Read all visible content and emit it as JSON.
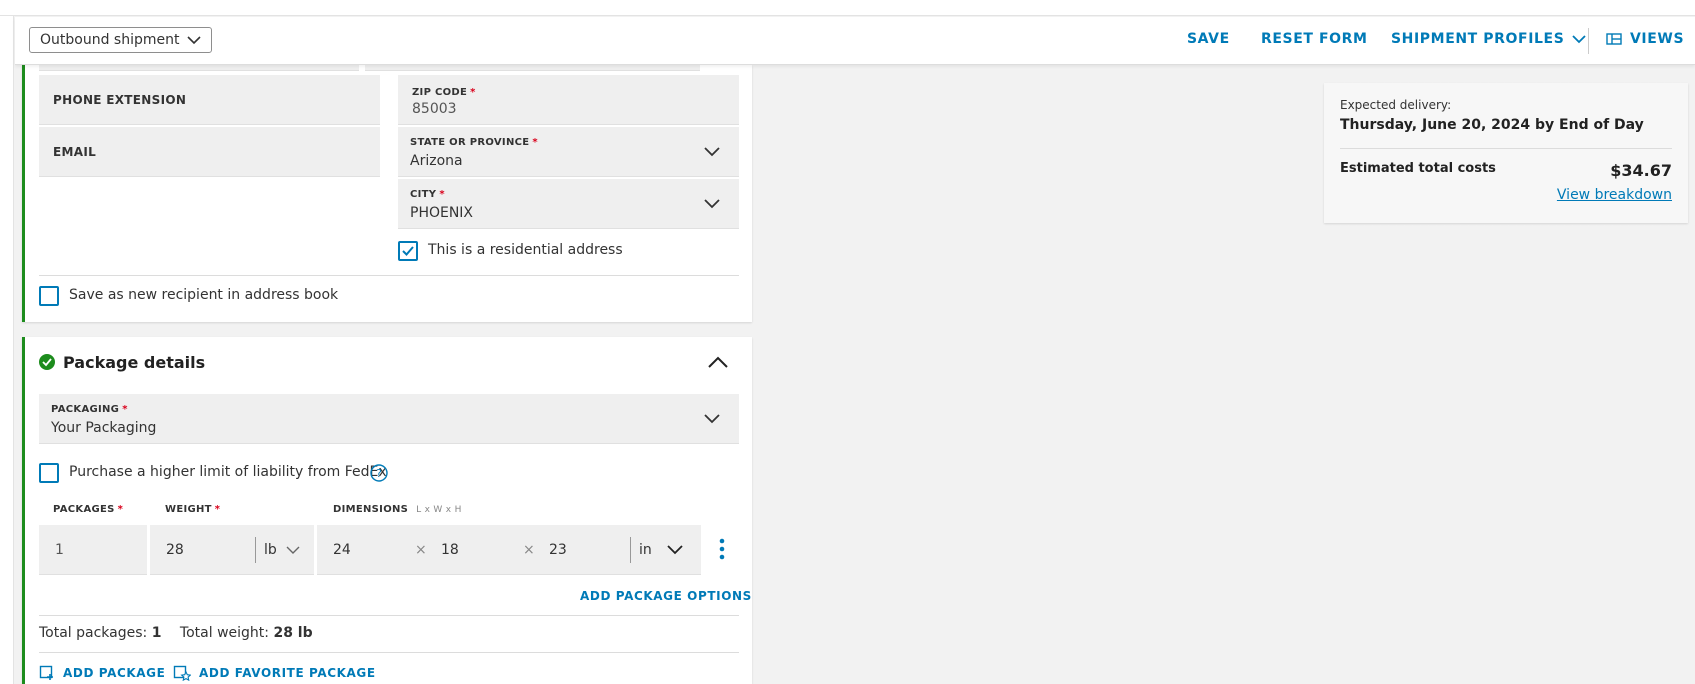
{
  "toolbar": {
    "shipment_type": "Outbound shipment",
    "save_label": "SAVE",
    "reset_label": "RESET FORM",
    "profiles_label": "SHIPMENT PROFILES",
    "views_label": "VIEWS"
  },
  "recipient": {
    "phone_extension_label": "PHONE EXTENSION",
    "email_label": "EMAIL",
    "zip_label": "ZIP CODE",
    "zip_value": "85003",
    "state_label": "STATE OR PROVINCE",
    "state_value": "Arizona",
    "city_label": "CITY",
    "city_value": "PHOENIX",
    "residential_label": "This is a residential address",
    "residential_checked": true,
    "save_recipient_label": "Save as new recipient in address book",
    "save_recipient_checked": false
  },
  "package": {
    "title": "Package details",
    "packaging_label": "PACKAGING",
    "packaging_value": "Your Packaging",
    "liability_label": "Purchase a higher limit of liability from FedEx",
    "packages_label": "PACKAGES",
    "weight_label": "WEIGHT",
    "dimensions_label": "DIMENSIONS",
    "dimensions_hint": "L x W x H",
    "packages_value": "1",
    "weight_value": "28",
    "weight_unit": "lb",
    "length_value": "24",
    "width_value": "18",
    "height_value": "23",
    "dim_unit": "in",
    "times_symbol": "×",
    "add_options_label": "ADD PACKAGE OPTIONS",
    "total_packages_label": "Total packages:",
    "total_packages_value": "1",
    "total_weight_label": "Total weight:",
    "total_weight_value": "28 lb",
    "add_package_label": "ADD PACKAGE",
    "add_favorite_label": "ADD FAVORITE PACKAGE"
  },
  "summary": {
    "expected_label": "Expected delivery:",
    "expected_value": "Thursday, June 20, 2024 by End of Day",
    "cost_label": "Estimated total costs",
    "cost_value": "$34.67",
    "breakdown_label": "View breakdown"
  },
  "colors": {
    "accent": "#007ab7",
    "success": "#1d8c1d",
    "required": "#d9001b"
  },
  "icons": [
    "chevron-down-icon",
    "chevron-up-icon",
    "check-icon",
    "check-circle-icon",
    "help-icon",
    "kebab-icon",
    "package-add-icon",
    "favorite-package-icon",
    "views-icon"
  ]
}
